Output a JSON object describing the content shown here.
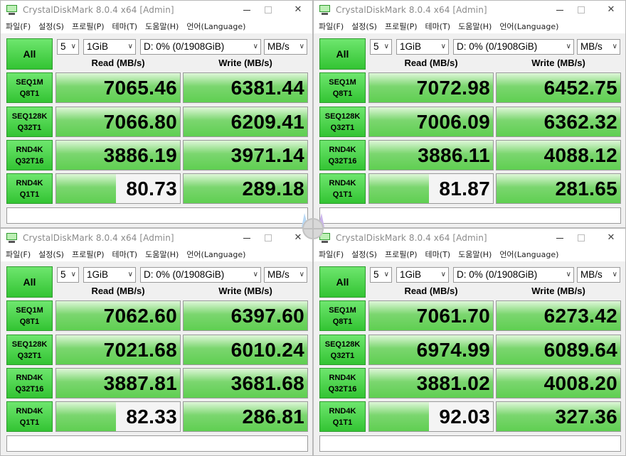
{
  "app": {
    "title": "CrystalDiskMark 8.0.4 x64 [Admin]",
    "menu": [
      "파일(F)",
      "설정(S)",
      "프로필(P)",
      "테마(T)",
      "도움말(H)",
      "언어(Language)"
    ],
    "all_button": "All",
    "col_read": "Read (MB/s)",
    "col_write": "Write (MB/s)",
    "tests": [
      {
        "line1": "SEQ1M",
        "line2": "Q8T1"
      },
      {
        "line1": "SEQ128K",
        "line2": "Q32T1"
      },
      {
        "line1": "RND4K",
        "line2": "Q32T16"
      },
      {
        "line1": "RND4K",
        "line2": "Q1T1"
      }
    ],
    "colors": {
      "accent_green": "#33c433",
      "bar_green": "#7bd66f",
      "title_text": "#8a8a8a"
    }
  },
  "windows": [
    {
      "count": "5",
      "size": "1GiB",
      "drive": "D: 0% (0/1908GiB)",
      "unit": "MB/s",
      "results": [
        {
          "read": "7065.46",
          "write": "6381.44",
          "read_level": 1.0,
          "write_level": 1.0
        },
        {
          "read": "7066.80",
          "write": "6209.41",
          "read_level": 1.0,
          "write_level": 1.0
        },
        {
          "read": "3886.19",
          "write": "3971.14",
          "read_level": 1.0,
          "write_level": 1.0
        },
        {
          "read": "80.73",
          "write": "289.18",
          "read_level": 0.48,
          "write_level": 1.0
        }
      ]
    },
    {
      "count": "5",
      "size": "1GiB",
      "drive": "D: 0% (0/1908GiB)",
      "unit": "MB/s",
      "results": [
        {
          "read": "7072.98",
          "write": "6452.75",
          "read_level": 1.0,
          "write_level": 1.0
        },
        {
          "read": "7006.09",
          "write": "6362.32",
          "read_level": 1.0,
          "write_level": 1.0
        },
        {
          "read": "3886.11",
          "write": "4088.12",
          "read_level": 1.0,
          "write_level": 1.0
        },
        {
          "read": "81.87",
          "write": "281.65",
          "read_level": 0.48,
          "write_level": 1.0
        }
      ]
    },
    {
      "count": "5",
      "size": "1GiB",
      "drive": "D: 0% (0/1908GiB)",
      "unit": "MB/s",
      "results": [
        {
          "read": "7062.60",
          "write": "6397.60",
          "read_level": 1.0,
          "write_level": 1.0
        },
        {
          "read": "7021.68",
          "write": "6010.24",
          "read_level": 1.0,
          "write_level": 1.0
        },
        {
          "read": "3887.81",
          "write": "3681.68",
          "read_level": 1.0,
          "write_level": 1.0
        },
        {
          "read": "82.33",
          "write": "286.81",
          "read_level": 0.48,
          "write_level": 1.0
        }
      ]
    },
    {
      "count": "5",
      "size": "1GiB",
      "drive": "D: 0% (0/1908GiB)",
      "unit": "MB/s",
      "results": [
        {
          "read": "7061.70",
          "write": "6273.42",
          "read_level": 1.0,
          "write_level": 1.0
        },
        {
          "read": "6974.99",
          "write": "6089.64",
          "read_level": 1.0,
          "write_level": 1.0
        },
        {
          "read": "3881.02",
          "write": "4008.20",
          "read_level": 1.0,
          "write_level": 1.0
        },
        {
          "read": "92.03",
          "write": "327.36",
          "read_level": 0.48,
          "write_level": 1.0
        }
      ]
    }
  ]
}
